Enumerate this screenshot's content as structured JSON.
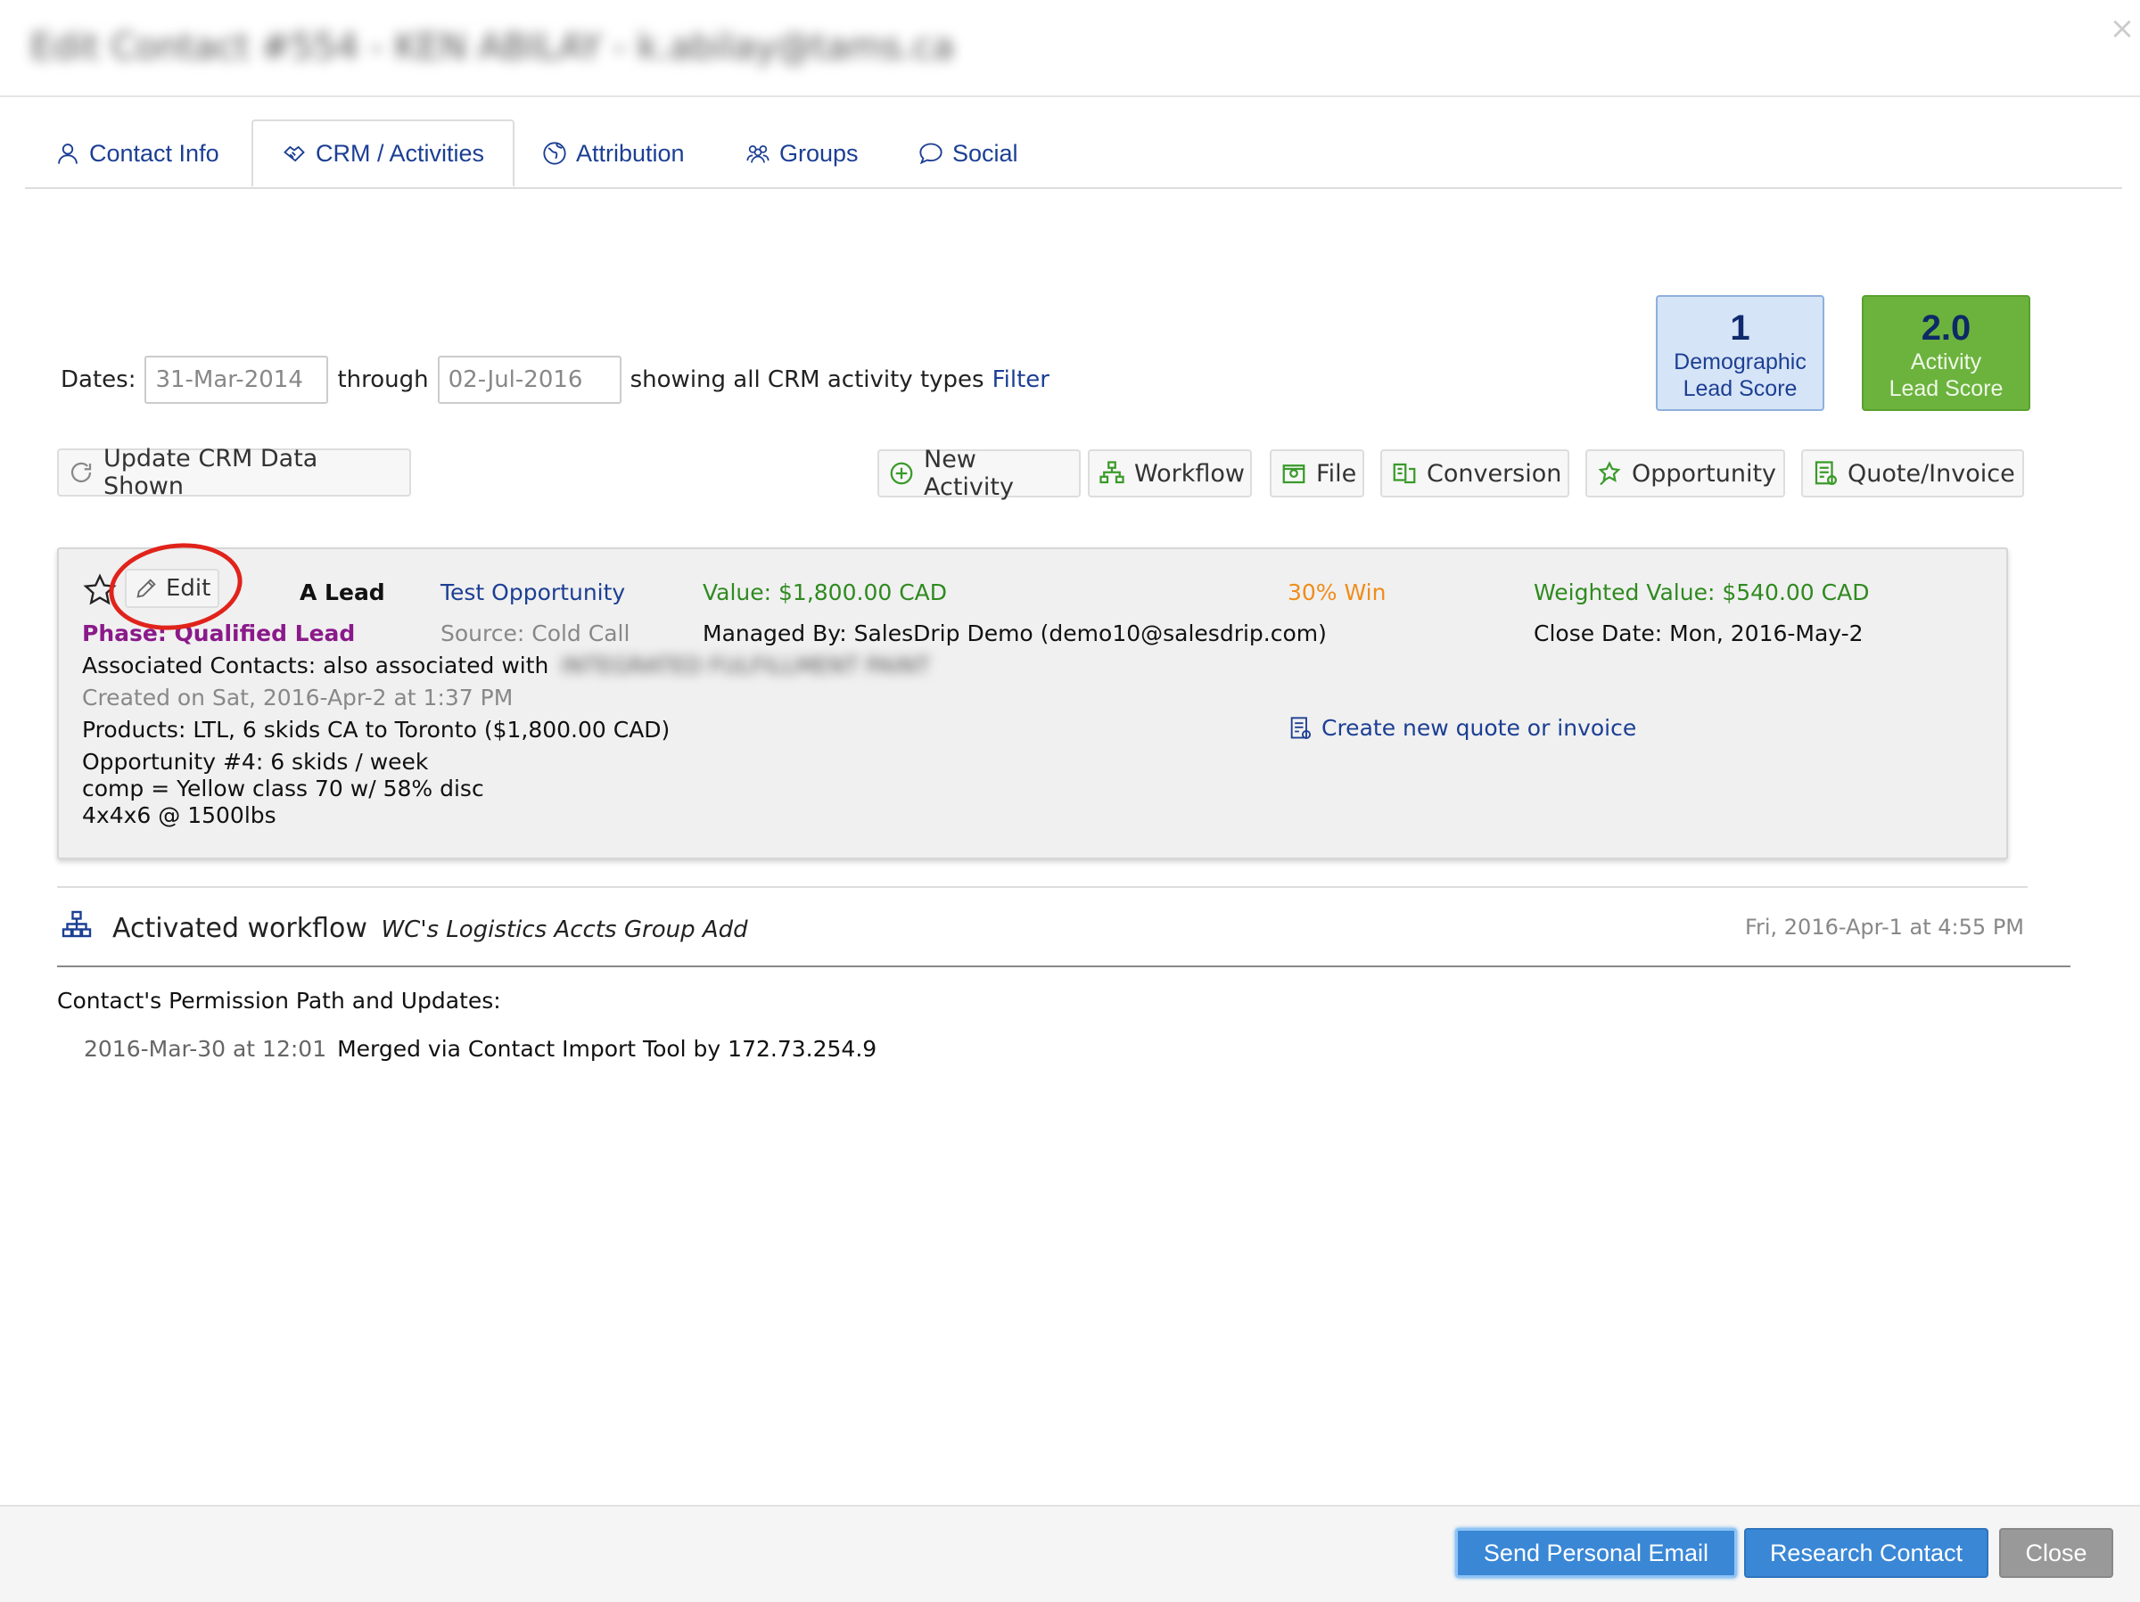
{
  "header": {
    "title": "Edit Contact #554 - KEN ABILAY - k.abilay@tams.ca",
    "close_glyph": "×"
  },
  "tabs": [
    {
      "label": "Contact Info",
      "icon": "user-icon"
    },
    {
      "label": "CRM / Activities",
      "icon": "handshake-icon"
    },
    {
      "label": "Attribution",
      "icon": "globe-icon"
    },
    {
      "label": "Groups",
      "icon": "group-icon"
    },
    {
      "label": "Social",
      "icon": "speech-bubble-icon"
    }
  ],
  "filters": {
    "dates_label": "Dates:",
    "start_date": "31-Mar-2014",
    "through_label": "through",
    "end_date": "02-Jul-2016",
    "showing_text": "showing all CRM activity types",
    "filter_link": "Filter"
  },
  "scores": {
    "demographic": {
      "value": "1",
      "label_1": "Demographic",
      "label_2": "Lead Score"
    },
    "activity": {
      "value": "2.0",
      "label_1": "Activity",
      "label_2": "Lead Score"
    }
  },
  "toolbar": {
    "update": "Update CRM Data Shown",
    "new_activity": "New Activity",
    "workflow": "Workflow",
    "file": "File",
    "conversion": "Conversion",
    "opportunity": "Opportunity",
    "quote_invoice": "Quote/Invoice"
  },
  "card": {
    "edit": "Edit",
    "lead_type": "A Lead",
    "opportunity_name": "Test Opportunity",
    "value": "Value: $1,800.00 CAD",
    "win": "30% Win",
    "weighted": "Weighted Value: $540.00 CAD",
    "phase": "Phase: Qualified Lead",
    "source": "Source: Cold Call",
    "managed_by": "Managed By: SalesDrip Demo (demo10@salesdrip.com)",
    "close_date": "Close Date: Mon, 2016-May-2",
    "associated": "Associated Contacts: also associated with",
    "associated_blurred": "INTEGRATED FULFILLMENT PAINT",
    "created": "Created on Sat, 2016-Apr-2 at 1:37 PM",
    "products": "Products: LTL, 6 skids CA to Toronto ($1,800.00 CAD)",
    "create_quote": "Create new quote or invoice",
    "note_1": "Opportunity #4: 6 skids / week",
    "note_2": "comp = Yellow class 70 w/ 58% disc",
    "note_3": "4x4x6 @ 1500lbs"
  },
  "workflow_entry": {
    "text": "Activated workflow",
    "name": "WC's Logistics Accts Group Add",
    "time": "Fri, 2016-Apr-1 at 4:55 PM"
  },
  "permission": {
    "title": "Contact's Permission Path and Updates:",
    "date": "2016-Mar-30 at 12:01",
    "text": "Merged via Contact Import Tool by 172.73.254.9"
  },
  "footer": {
    "send_email": "Send Personal Email",
    "research": "Research Contact",
    "close": "Close"
  },
  "colors": {
    "link_blue": "#1c3f94",
    "green": "#2f8a1f",
    "orange": "#f08c1a",
    "purple": "#8a1a8a",
    "primary_btn": "#3a87d6",
    "close_btn": "#999999"
  }
}
